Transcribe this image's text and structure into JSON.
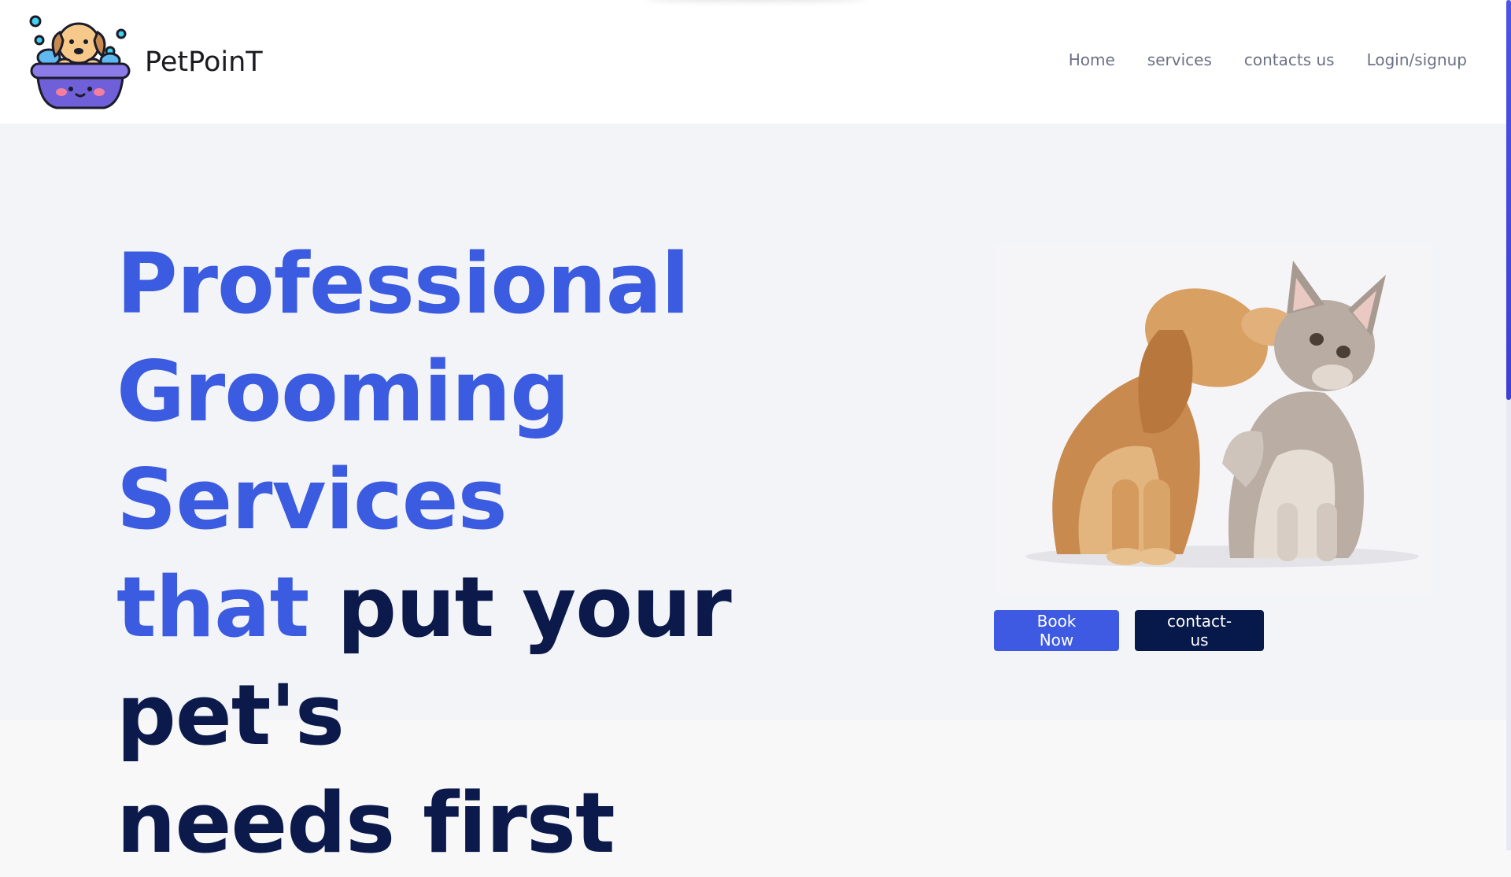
{
  "brand": {
    "name": "PetPoinT"
  },
  "nav": {
    "links": [
      {
        "label": "Home"
      },
      {
        "label": "services"
      },
      {
        "label": "contacts us"
      },
      {
        "label": "Login/signup"
      }
    ]
  },
  "hero": {
    "headline_accent_line1": "Professional",
    "headline_accent_line2": "Grooming Services",
    "headline_accent_line3": "that",
    "headline_rest_line3": " put your pet's",
    "headline_rest_line4": "needs first",
    "buttons": {
      "book_label": "Book Now",
      "contact_label": "contact-us"
    },
    "image_subject": "puppy-and-kitten"
  },
  "colors": {
    "accent": "#3b5be0",
    "dark": "#0b1a4b",
    "book_button": "#3e5ae2",
    "contact_button": "#07194a",
    "scrollbar": "#4a55e3"
  }
}
